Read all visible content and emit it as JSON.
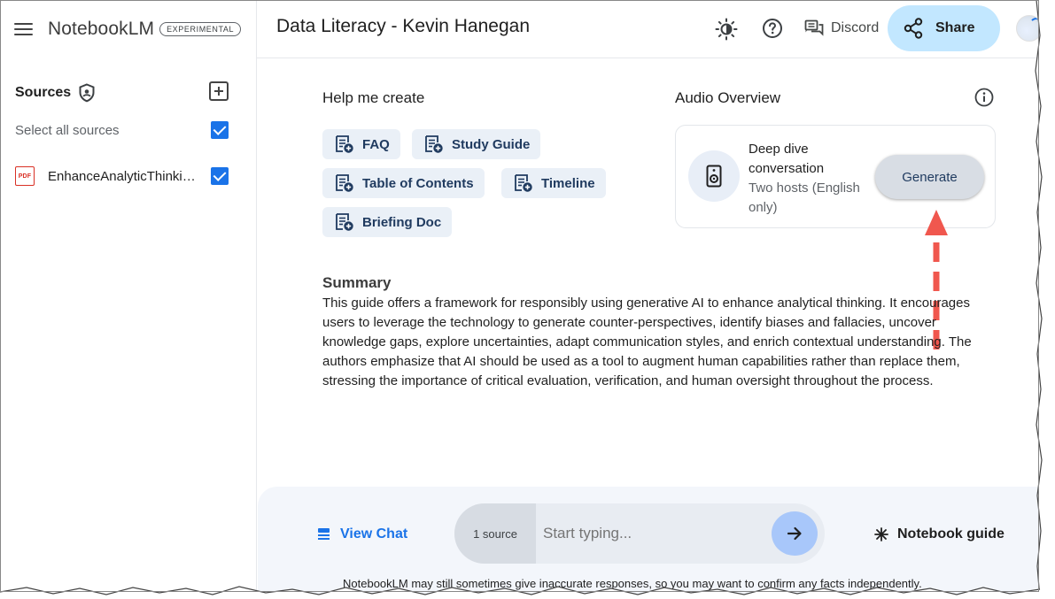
{
  "brand": {
    "name": "NotebookLM",
    "badge": "EXPERIMENTAL"
  },
  "sidebar": {
    "sources_title": "Sources",
    "select_all_label": "Select all sources",
    "select_all_checked": true,
    "items": [
      {
        "badge": "PDF",
        "label": "EnhanceAnalyticThinkingWithGenAI.pdf",
        "checked": true
      }
    ]
  },
  "header": {
    "notebook_title": "Data Literacy - Kevin Hanegan",
    "discord_label": "Discord",
    "share_label": "Share"
  },
  "help_create": {
    "title": "Help me create",
    "chips": [
      {
        "label": "FAQ"
      },
      {
        "label": "Study Guide"
      },
      {
        "label": "Table of Contents"
      },
      {
        "label": "Timeline"
      },
      {
        "label": "Briefing Doc"
      }
    ]
  },
  "audio_overview": {
    "title": "Audio Overview",
    "card_title": "Deep dive conversation",
    "card_subtitle": "Two hosts (English only)",
    "generate_label": "Generate"
  },
  "summary": {
    "title": "Summary",
    "text": "This guide offers a framework for responsibly using generative AI to enhance analytical thinking. It encourages users to leverage the technology to generate counter-perspectives, identify biases and fallacies, uncover knowledge gaps, explore uncertainties, adapt communication styles, and enrich contextual understanding. The authors emphasize that AI should be used as a tool to augment human capabilities rather than replace them, stressing the importance of critical evaluation, verification, and human oversight throughout the process."
  },
  "chat": {
    "view_chat_label": "View Chat",
    "source_count": "1 source",
    "placeholder": "Start typing...",
    "notebook_guide_label": "Notebook guide",
    "disclaimer": "NotebookLM may still sometimes give inaccurate responses, so you may want to confirm any facts independently."
  },
  "colors": {
    "accent": "#1a73e8",
    "share_bg": "#c2e7ff",
    "chip_bg": "#eaf0f7",
    "annotation_arrow": "#f0574e"
  },
  "icons": {
    "menu": "hamburger-icon",
    "shield": "shield-icon",
    "add": "add-source-icon",
    "theme": "brightness-icon",
    "help": "help-icon",
    "discord": "chat-bubble-icon",
    "share": "share-icon",
    "doc": "doc-add-icon",
    "info": "info-icon",
    "speaker": "speaker-icon",
    "view_chat": "chat-list-icon",
    "send": "arrow-right-icon",
    "notebook_guide": "asterisk-icon"
  }
}
